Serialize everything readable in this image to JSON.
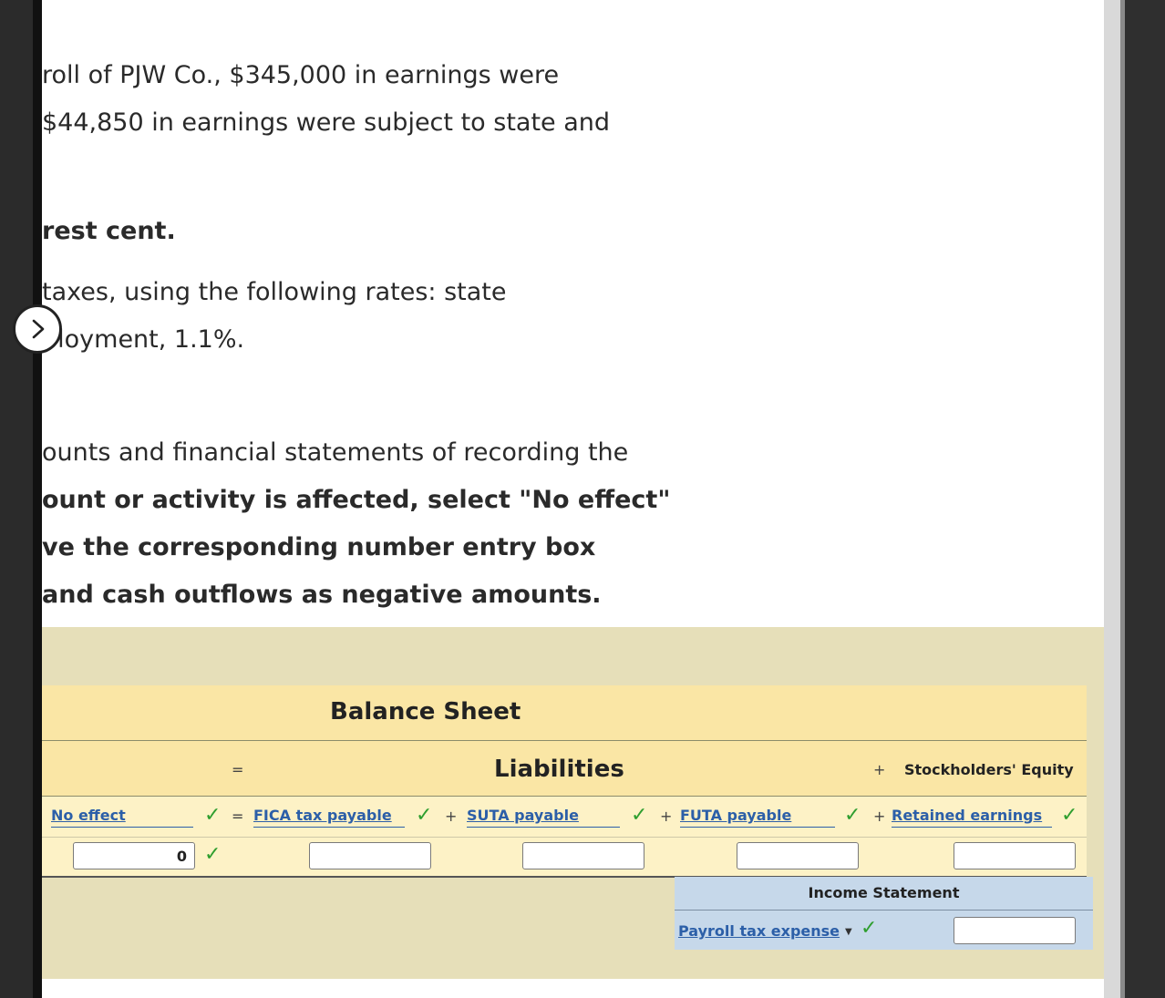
{
  "problem_text": {
    "line1": "roll of PJW Co., $345,000 in earnings were",
    "line2": " $44,850 in earnings were subject to state and",
    "line3": "rest cent.",
    "line4": " taxes, using the following rates: state",
    "line5": "ployment, 1.1%.",
    "line6": "ounts and financial statements of recording the",
    "line7": "ount or activity is affected, select \"No effect\"",
    "line8": "ve the corresponding number entry box",
    "line9": "and cash outflows as negative amounts."
  },
  "balance_sheet": {
    "title": "Balance Sheet",
    "liabilities_header": "Liabilities",
    "equity_header": "Stockholders' Equity",
    "symbols": {
      "equals": "=",
      "plus": "+"
    },
    "accounts": [
      {
        "label": "No effect",
        "value": "0"
      },
      {
        "label": "FICA tax payable",
        "value": ""
      },
      {
        "label": "SUTA payable",
        "value": ""
      },
      {
        "label": "FUTA payable",
        "value": ""
      },
      {
        "label": "Retained earnings",
        "value": ""
      }
    ],
    "check_mark": "✓"
  },
  "income_statement": {
    "title": "Income Statement",
    "account": "Payroll tax expense",
    "value": ""
  },
  "icons": {
    "expand": "chevron-right-icon",
    "check": "check-icon",
    "dropdown": "caret-down-icon"
  },
  "colors": {
    "panel_bg": "#e6dfb9",
    "balance_header": "#fae6a5",
    "balance_body": "#fdf2c6",
    "income_bg": "#c6d8ea",
    "link": "#2c5fa8",
    "check": "#2e9e2e"
  }
}
